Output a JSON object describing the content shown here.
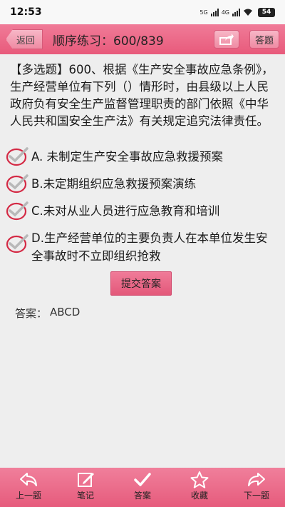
{
  "statusbar": {
    "time": "12:53",
    "network1": "5G",
    "network2": "4G",
    "battery": "54"
  },
  "header": {
    "back_label": "返回",
    "title": "顺序练习：600/839",
    "answer_label": "答题"
  },
  "question": {
    "text": "【多选题】600、根据《生产安全事故应急条例》，生产经营单位有下列（）情形时，由县级以上人民政府负有安全生产监督管理职责的部门依照《中华人民共和国安全生产法》有关规定追究法律责任。"
  },
  "options": [
    {
      "text": "A. 未制定生产安全事故应急救援预案",
      "checked": true
    },
    {
      "text": "B.未定期组织应急救援预案演练",
      "checked": true
    },
    {
      "text": "C.未对从业人员进行应急教育和培训",
      "checked": true
    },
    {
      "text": "D.生产经营单位的主要负责人在本单位发生安全事故时不立即组织抢救",
      "checked": true
    }
  ],
  "submit_label": "提交答案",
  "result": {
    "label": "答案：",
    "value": "ABCD"
  },
  "bottom_nav": [
    {
      "label": "上一题",
      "icon": "arrow-left-icon"
    },
    {
      "label": "笔记",
      "icon": "note-edit-icon"
    },
    {
      "label": "答案",
      "icon": "checkmark-icon"
    },
    {
      "label": "收藏",
      "icon": "star-icon"
    },
    {
      "label": "下一题",
      "icon": "arrow-right-icon"
    }
  ],
  "colors": {
    "accent": "#e85a7b",
    "check_red": "#d42a45",
    "background": "#eeeeee"
  }
}
